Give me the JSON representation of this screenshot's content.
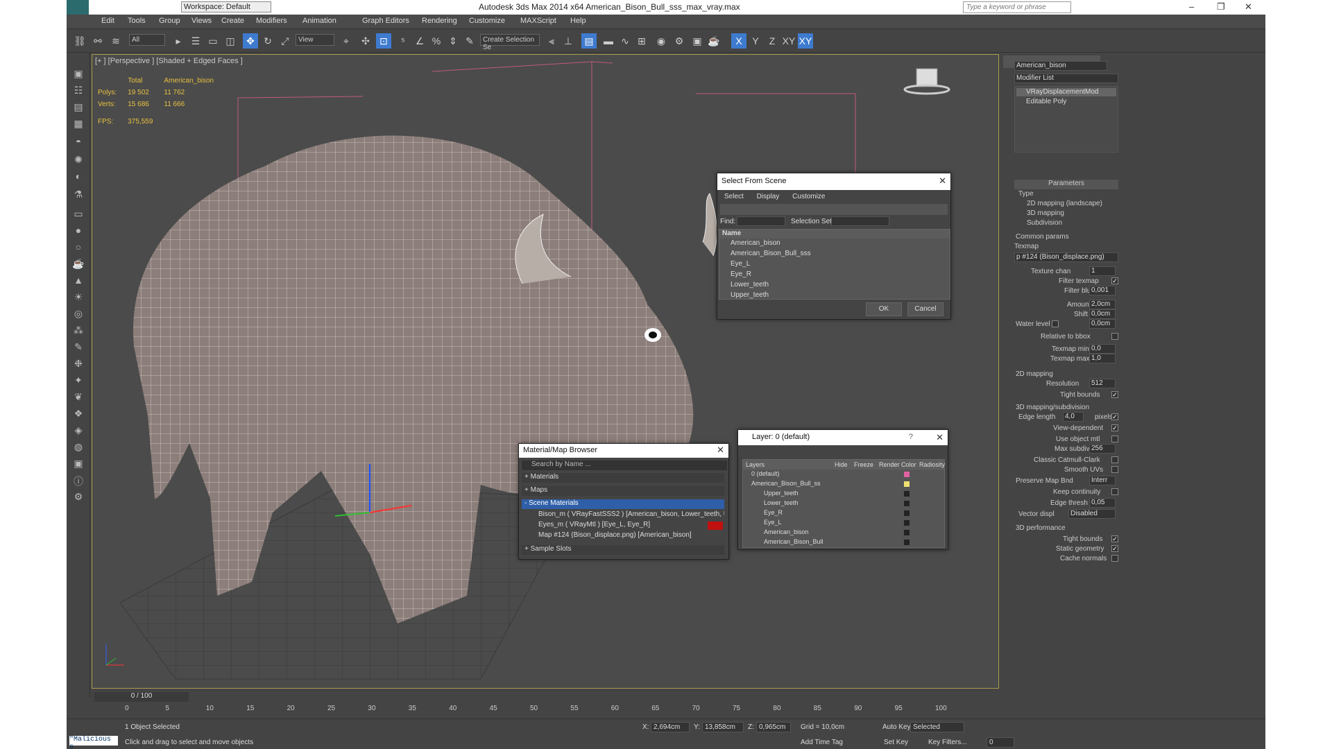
{
  "titlebar": {
    "workspace": "Workspace: Default",
    "title": "Autodesk 3ds Max  2014 x64      American_Bison_Bull_sss_max_vray.max",
    "search_placeholder": "Type a keyword or phrase"
  },
  "menu": [
    "Edit",
    "Tools",
    "Group",
    "Views",
    "Create",
    "Modifiers",
    "Animation",
    "Graph Editors",
    "Rendering",
    "Customize",
    "MAXScript",
    "Help"
  ],
  "toolbar": {
    "filter": "All",
    "coord": "View",
    "selection_set": "Create Selection Se",
    "axes": [
      "X",
      "Y",
      "Z",
      "XY",
      "XY"
    ]
  },
  "viewport": {
    "label": "[+ ] [Perspective ] [Shaded + Edged Faces ]",
    "stats": {
      "col_total": "Total",
      "col_obj": "American_bison",
      "polys_label": "Polys:",
      "polys_total": "19 502",
      "polys_obj": "11 762",
      "verts_label": "Verts:",
      "verts_total": "15 686",
      "verts_obj": "11 666",
      "fps_label": "FPS:",
      "fps": "375,559"
    }
  },
  "select_from_scene": {
    "title": "Select From Scene",
    "tabs": [
      "Select",
      "Display",
      "Customize"
    ],
    "find_label": "Find:",
    "selection_set_label": "Selection Set:",
    "column": "Name",
    "items": [
      "American_bison",
      "American_Bison_Bull_sss",
      "Eye_L",
      "Eye_R",
      "Lower_teeth",
      "Upper_teeth"
    ],
    "ok": "OK",
    "cancel": "Cancel"
  },
  "material_browser": {
    "title": "Material/Map Browser",
    "search_placeholder": "Search by Name ...",
    "sections": [
      "+ Materials",
      "+ Maps",
      "- Scene Materials",
      "+ Sample Slots"
    ],
    "scene_items": [
      "Bison_m  ( VRayFastSSS2 )  [American_bison, Lower_teeth, Upper_t...",
      "Eyes_m  ( VRayMtl )  [Eye_L, Eye_R]",
      "Map #124 (Bison_displace.png) [American_bison]"
    ]
  },
  "layer_dialog": {
    "title": "Layer: 0 (default)",
    "help": "?",
    "columns": [
      "Layers",
      "Hide",
      "Freeze",
      "Render",
      "Color",
      "Radiosity"
    ],
    "rows": [
      "0 (default)",
      "American_Bison_Bull_ss",
      "Upper_teeth",
      "Lower_teeth",
      "Eye_R",
      "Eye_L",
      "American_bison",
      "American_Bison_Bull"
    ],
    "row_colors": [
      "#e060a0",
      "#f0e070",
      "#222222",
      "#222222",
      "#222222",
      "#222222",
      "#222222",
      "#222222"
    ]
  },
  "command_panel": {
    "object_name": "American_bison",
    "modifier_list": "Modifier List",
    "stack": [
      "VRayDisplacementMod",
      "Editable Poly"
    ],
    "params_title": "Parameters",
    "type_label": "Type",
    "type_options": [
      "2D mapping (landscape)",
      "3D mapping",
      "Subdivision"
    ],
    "common_params": "Common params",
    "texmap_label": "Texmap",
    "texmap_value": "p #124 (Bison_displace.png)",
    "texture_chan_label": "Texture chan",
    "texture_chan": "1",
    "filter_texmap": "Filter texmap",
    "filter_blur_label": "Filter blur",
    "filter_blur": "0,001",
    "amount_label": "Amount",
    "amount": "2,0cm",
    "shift_label": "Shift",
    "shift": "0,0cm",
    "water_level_label": "Water level",
    "water_level": "0,0cm",
    "relative_bbox": "Relative to bbox",
    "texmap_min_label": "Texmap min",
    "texmap_min": "0,0",
    "texmap_max_label": "Texmap max",
    "texmap_max": "1,0",
    "mapping2d": "2D mapping",
    "resolution_label": "Resolution",
    "resolution": "512",
    "tight_bounds": "Tight bounds",
    "mapping3d": "3D mapping/subdivision",
    "edge_length_label": "Edge length",
    "edge_length": "4,0",
    "pixels": "pixels",
    "view_dependent": "View-dependent",
    "use_object_mtl": "Use object mtl",
    "max_subdivs_label": "Max subdivs",
    "max_subdivs": "256",
    "classic": "Classic Catmull-Clark",
    "smooth_uvs": "Smooth UVs",
    "preserve_label": "Preserve Map Bnd",
    "preserve": "Interr",
    "keep_continuity": "Keep continuity",
    "edge_thresh_label": "Edge thresh",
    "edge_thresh": "0,05",
    "vector_disp_label": "Vector displ",
    "vector_disp": "Disabled",
    "perf": "3D performance",
    "tight_bounds2": "Tight bounds",
    "static_geom": "Static geometry",
    "cache_normals": "Cache normals"
  },
  "timeline": {
    "frame": "0 / 100",
    "ticks": [
      "0",
      "5",
      "10",
      "15",
      "20",
      "25",
      "30",
      "35",
      "40",
      "45",
      "50",
      "55",
      "60",
      "65",
      "70",
      "75",
      "80",
      "85",
      "90",
      "95",
      "100"
    ]
  },
  "status": {
    "maxscript": "\"Malicious s",
    "selected": "1 Object Selected",
    "prompt": "Click and drag to select and move objects",
    "x_label": "X:",
    "x": "2,694cm",
    "y_label": "Y:",
    "y": "13,858cm",
    "z_label": "Z:",
    "z": "0,965cm",
    "grid": "Grid = 10,0cm",
    "add_time_tag": "Add Time Tag",
    "auto_key": "Auto Key",
    "set_key": "Set Key",
    "selected_dd": "Selected",
    "key_filters": "Key Filters...",
    "frame": "0"
  }
}
